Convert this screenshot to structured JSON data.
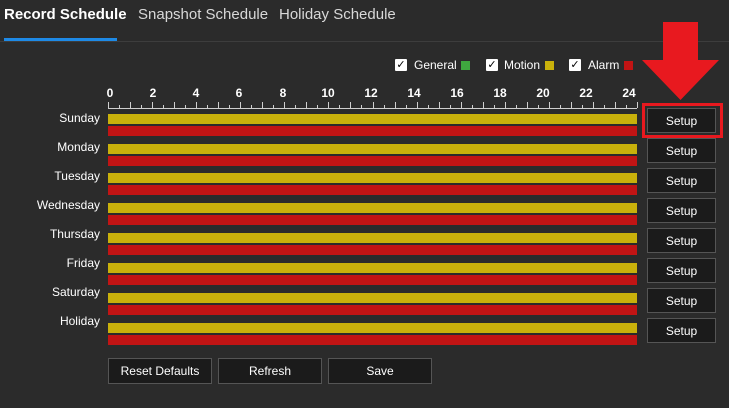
{
  "tabs": [
    {
      "label": "Record Schedule",
      "active": true
    },
    {
      "label": "Snapshot Schedule",
      "active": false
    },
    {
      "label": "Holiday Schedule",
      "active": false
    }
  ],
  "legend": [
    {
      "label": "General",
      "checked": true,
      "color": "#3fa83f"
    },
    {
      "label": "Motion",
      "checked": true,
      "color": "#c9b10b"
    },
    {
      "label": "Alarm",
      "checked": true,
      "color": "#c11414"
    }
  ],
  "axis": {
    "labels": [
      "0",
      "2",
      "4",
      "6",
      "8",
      "10",
      "12",
      "14",
      "16",
      "18",
      "20",
      "22",
      "24"
    ]
  },
  "days": [
    {
      "name": "Sunday",
      "setup": "Setup",
      "highlighted": true
    },
    {
      "name": "Monday",
      "setup": "Setup"
    },
    {
      "name": "Tuesday",
      "setup": "Setup"
    },
    {
      "name": "Wednesday",
      "setup": "Setup"
    },
    {
      "name": "Thursday",
      "setup": "Setup"
    },
    {
      "name": "Friday",
      "setup": "Setup"
    },
    {
      "name": "Saturday",
      "setup": "Setup"
    },
    {
      "name": "Holiday",
      "setup": "Setup"
    }
  ],
  "buttons": {
    "reset": "Reset Defaults",
    "refresh": "Refresh",
    "save": "Save"
  },
  "colors": {
    "accent": "#1e8ae6",
    "motion": "#c9b10b",
    "alarm": "#c11414",
    "highlight": "#e8191f"
  }
}
